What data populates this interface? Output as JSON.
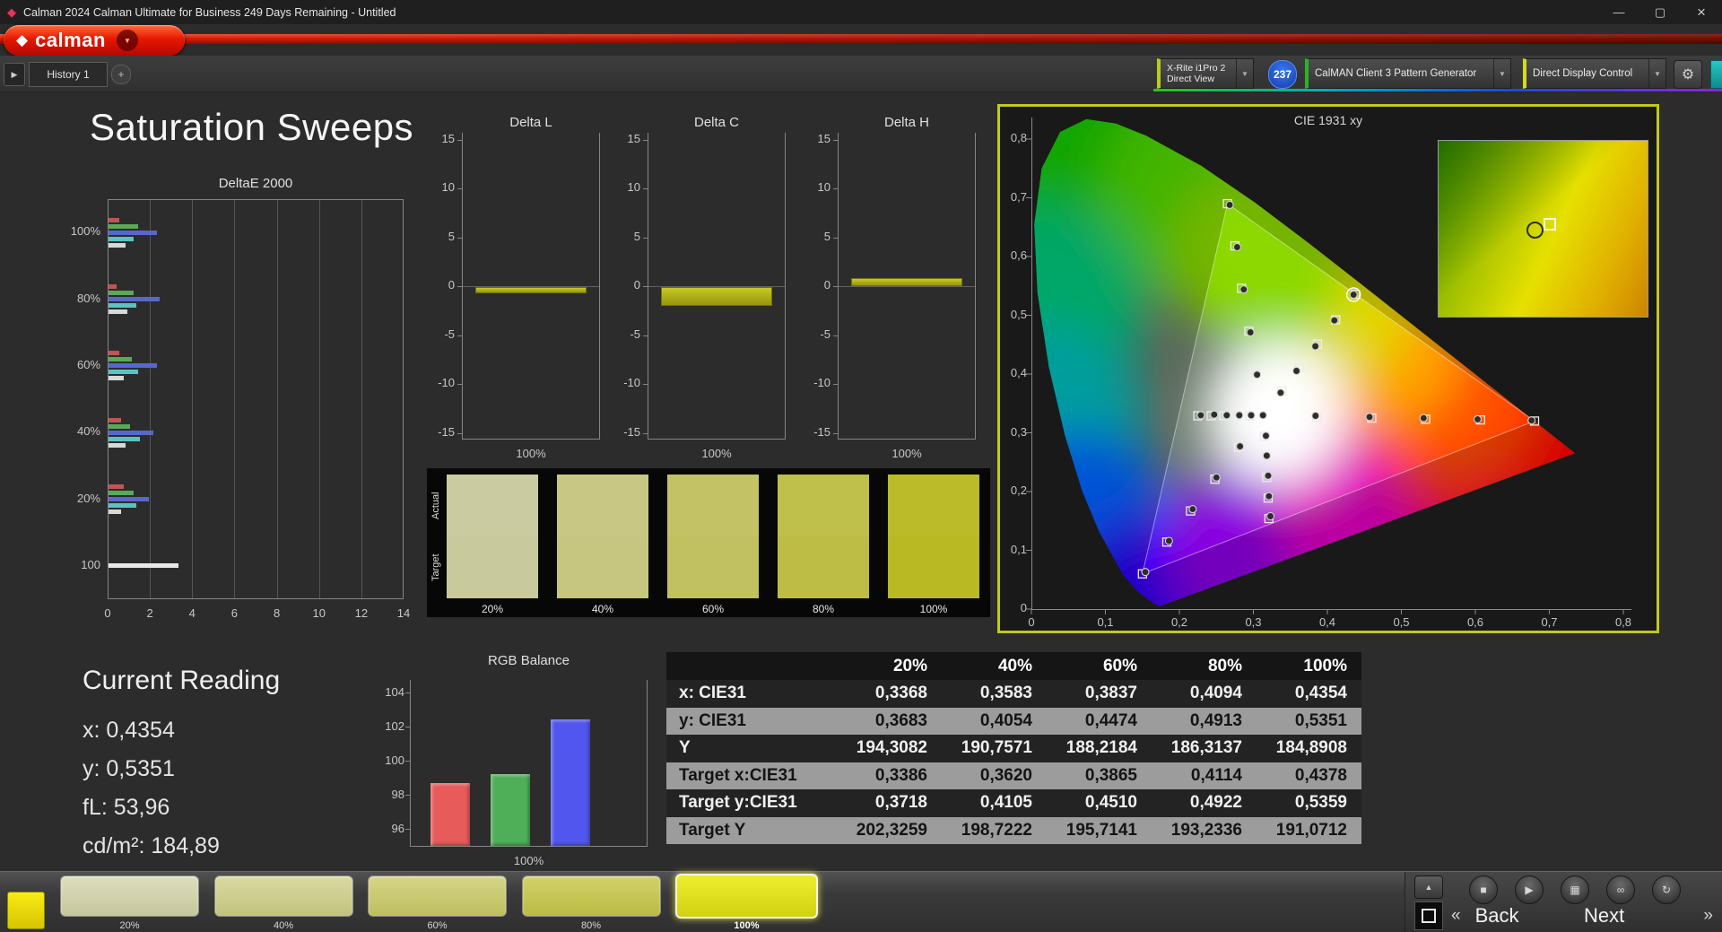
{
  "titlebar": {
    "title": "Calman 2024 Calman Ultimate for Business 249 Days Remaining  - Untitled"
  },
  "brand": {
    "name": "calman"
  },
  "icons": {
    "logo_glyph": "◆",
    "app_glyph": "◆",
    "dropdown_arrow": "▼",
    "minimize": "—",
    "maximize": "▢",
    "close": "×",
    "gear": "⚙",
    "tab_expand": "▶",
    "add_tab": "+",
    "eject": "▲",
    "stop": "■",
    "play": "▶",
    "save": "▦",
    "link": "∞",
    "refresh": "↻",
    "back_chevrons": "«",
    "next_chevrons": "»"
  },
  "tabs": {
    "history": "History 1"
  },
  "toolbar": {
    "meter_line1": "X-Rite i1Pro 2",
    "meter_line2": "Direct View",
    "meter_badge": "237",
    "pattern_generator": "CalMAN Client 3 Pattern Generator",
    "display_control": "Direct Display Control"
  },
  "page": {
    "title": "Saturation Sweeps"
  },
  "current_reading": {
    "title": "Current Reading",
    "lines": [
      {
        "label": "x:",
        "value": "0,4354"
      },
      {
        "label": "y:",
        "value": "0,5351"
      },
      {
        "label": "fL:",
        "value": "53,96"
      },
      {
        "label": "cd/m²:",
        "value": "184,89"
      }
    ]
  },
  "chart_data": {
    "deltaE2000": {
      "type": "bar",
      "orientation": "horizontal",
      "title": "DeltaE 2000",
      "xlim": [
        0,
        14
      ],
      "xticks": [
        0,
        2,
        4,
        6,
        8,
        10,
        12,
        14
      ],
      "bar_colors": [
        "#c25454",
        "#58aa58",
        "#5868c8",
        "#5cc2c2",
        "#d8d8d8"
      ],
      "groups": [
        {
          "label": "100%",
          "values": [
            0.5,
            1.4,
            2.3,
            1.2,
            0.8
          ]
        },
        {
          "label": "80%",
          "values": [
            0.4,
            1.2,
            2.4,
            1.3,
            0.9
          ]
        },
        {
          "label": "60%",
          "values": [
            0.5,
            1.1,
            2.3,
            1.4,
            0.7
          ]
        },
        {
          "label": "40%",
          "values": [
            0.6,
            1.0,
            2.1,
            1.5,
            0.8
          ]
        },
        {
          "label": "20%",
          "values": [
            0.7,
            1.2,
            1.9,
            1.3,
            0.6
          ]
        },
        {
          "label": "100",
          "values": [
            3.3
          ],
          "colors": [
            "#e8e8e8"
          ]
        }
      ]
    },
    "deltaL": {
      "type": "bar",
      "title": "Delta L",
      "value": -0.6,
      "ylim": [
        -15,
        15
      ],
      "yticks": [
        15,
        10,
        5,
        0,
        -5,
        -10,
        -15
      ],
      "xlabel": "100%",
      "color": "#b6b618"
    },
    "deltaC": {
      "type": "bar",
      "title": "Delta C",
      "value": -1.9,
      "ylim": [
        -15,
        15
      ],
      "yticks": [
        15,
        10,
        5,
        0,
        -5,
        -10,
        -15
      ],
      "xlabel": "100%",
      "color": "#b6b618"
    },
    "deltaH": {
      "type": "bar",
      "title": "Delta H",
      "value": 0.8,
      "ylim": [
        -15,
        15
      ],
      "yticks": [
        15,
        10,
        5,
        0,
        -5,
        -10,
        -15
      ],
      "xlabel": "100%",
      "color": "#b6b618"
    },
    "rgb_balance": {
      "type": "bar",
      "title": "RGB Balance",
      "categories": [
        "Red",
        "Green",
        "Blue"
      ],
      "values": [
        98.7,
        99.2,
        102.4
      ],
      "colors": [
        "#e85b5b",
        "#4fae58",
        "#5156ee"
      ],
      "ylim": [
        95,
        104.5
      ],
      "yticks": [
        104,
        102,
        100,
        98,
        96
      ],
      "xlabel": "100%"
    },
    "cie1931": {
      "type": "scatter",
      "title": "CIE 1931 xy",
      "xlim": [
        0,
        0.8
      ],
      "ylim": [
        0,
        0.8
      ],
      "xtick_labels": [
        "0",
        "0,1",
        "0,2",
        "0,3",
        "0,4",
        "0,5",
        "0,6",
        "0,7",
        "0,8"
      ],
      "ytick_labels": [
        "0",
        "0,1",
        "0,2",
        "0,3",
        "0,4",
        "0,5",
        "0,6",
        "0,7",
        "0,8"
      ],
      "white_point": [
        0.313,
        0.329
      ],
      "gamut_triangle": [
        [
          0.68,
          0.32
        ],
        [
          0.265,
          0.69
        ],
        [
          0.15,
          0.06
        ]
      ],
      "current_point": [
        0.4354,
        0.5351
      ],
      "targets": [
        [
          0.386,
          0.327
        ],
        [
          0.46,
          0.325
        ],
        [
          0.533,
          0.323
        ],
        [
          0.607,
          0.322
        ],
        [
          0.68,
          0.32
        ],
        [
          0.303,
          0.401
        ],
        [
          0.294,
          0.473
        ],
        [
          0.284,
          0.546
        ],
        [
          0.275,
          0.618
        ],
        [
          0.265,
          0.69
        ],
        [
          0.28,
          0.275
        ],
        [
          0.248,
          0.221
        ],
        [
          0.215,
          0.167
        ],
        [
          0.183,
          0.114
        ],
        [
          0.15,
          0.06
        ],
        [
          0.295,
          0.329
        ],
        [
          0.278,
          0.329
        ],
        [
          0.26,
          0.329
        ],
        [
          0.243,
          0.329
        ],
        [
          0.225,
          0.329
        ],
        [
          0.315,
          0.294
        ],
        [
          0.317,
          0.259
        ],
        [
          0.318,
          0.224
        ],
        [
          0.32,
          0.189
        ],
        [
          0.321,
          0.154
        ],
        [
          0.3386,
          0.3718
        ],
        [
          0.362,
          0.4105
        ],
        [
          0.3865,
          0.451
        ],
        [
          0.4114,
          0.4922
        ],
        [
          0.4378,
          0.5359
        ]
      ],
      "measurements": [
        [
          0.3368,
          0.3683
        ],
        [
          0.3583,
          0.4054
        ],
        [
          0.3837,
          0.4474
        ],
        [
          0.4094,
          0.4913
        ],
        [
          0.4354,
          0.5351
        ],
        [
          0.297,
          0.33
        ],
        [
          0.281,
          0.33
        ],
        [
          0.264,
          0.33
        ],
        [
          0.247,
          0.331
        ],
        [
          0.229,
          0.33
        ],
        [
          0.384,
          0.329
        ],
        [
          0.457,
          0.327
        ],
        [
          0.53,
          0.325
        ],
        [
          0.603,
          0.323
        ],
        [
          0.676,
          0.321
        ],
        [
          0.305,
          0.399
        ],
        [
          0.296,
          0.471
        ],
        [
          0.287,
          0.544
        ],
        [
          0.278,
          0.616
        ],
        [
          0.268,
          0.688
        ],
        [
          0.282,
          0.277
        ],
        [
          0.25,
          0.224
        ],
        [
          0.218,
          0.17
        ],
        [
          0.186,
          0.116
        ],
        [
          0.154,
          0.063
        ],
        [
          0.317,
          0.295
        ],
        [
          0.318,
          0.261
        ],
        [
          0.32,
          0.227
        ],
        [
          0.321,
          0.192
        ],
        [
          0.323,
          0.158
        ],
        [
          0.313,
          0.33
        ]
      ]
    }
  },
  "swatch_panel": {
    "row_labels": [
      "Actual",
      "Target"
    ],
    "columns": [
      {
        "label": "20%",
        "actual": "#cbcba2",
        "target": "#c9c99e"
      },
      {
        "label": "40%",
        "actual": "#c8c884",
        "target": "#c6c680"
      },
      {
        "label": "60%",
        "actual": "#c3c366",
        "target": "#c1c162"
      },
      {
        "label": "80%",
        "actual": "#bfbf4b",
        "target": "#bdbd46"
      },
      {
        "label": "100%",
        "actual": "#bbbb2a",
        "target": "#b9b924"
      }
    ]
  },
  "table": {
    "header": [
      "",
      "20%",
      "40%",
      "60%",
      "80%",
      "100%"
    ],
    "rows": [
      {
        "label": "x: CIE31",
        "shade": "dark",
        "values": [
          "0,3368",
          "0,3583",
          "0,3837",
          "0,4094",
          "0,4354"
        ]
      },
      {
        "label": "y: CIE31",
        "shade": "light",
        "values": [
          "0,3683",
          "0,4054",
          "0,4474",
          "0,4913",
          "0,5351"
        ]
      },
      {
        "label": "Y",
        "shade": "dark",
        "values": [
          "194,3082",
          "190,7571",
          "188,2184",
          "186,3137",
          "184,8908"
        ]
      },
      {
        "label": "Target x:CIE31",
        "shade": "light",
        "values": [
          "0,3386",
          "0,3620",
          "0,3865",
          "0,4114",
          "0,4378"
        ]
      },
      {
        "label": "Target y:CIE31",
        "shade": "dark",
        "values": [
          "0,3718",
          "0,4105",
          "0,4510",
          "0,4922",
          "0,5359"
        ]
      },
      {
        "label": "Target Y",
        "shade": "light",
        "values": [
          "202,3259",
          "198,7222",
          "195,7141",
          "193,2336",
          "191,0712"
        ]
      }
    ]
  },
  "bottom_bar": {
    "swatches": [
      {
        "label": "20%",
        "top": "#dedebe",
        "bottom": "#c6c69c",
        "active": false
      },
      {
        "label": "40%",
        "top": "#dadaa4",
        "bottom": "#c2c27e",
        "active": false
      },
      {
        "label": "60%",
        "top": "#d6d688",
        "bottom": "#bebe5e",
        "active": false
      },
      {
        "label": "80%",
        "top": "#d2d26c",
        "bottom": "#baba42",
        "active": false
      },
      {
        "label": "100%",
        "top": "#eeee2e",
        "bottom": "#d2d212",
        "active": true
      }
    ],
    "back_label": "Back",
    "next_label": "Next"
  }
}
